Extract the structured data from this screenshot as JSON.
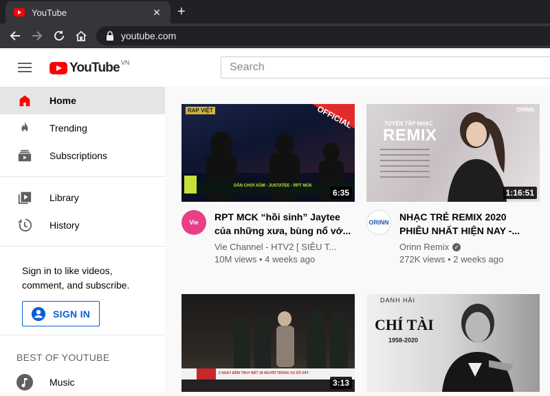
{
  "browser": {
    "tab_title": "YouTube",
    "tab_close": "✕",
    "new_tab": "+",
    "url": "youtube.com"
  },
  "masthead": {
    "logo_text": "YouTube",
    "logo_country": "VN",
    "search_placeholder": "Search"
  },
  "sidebar": {
    "items": [
      {
        "label": "Home",
        "icon": "home-icon",
        "active": true
      },
      {
        "label": "Trending",
        "icon": "fire-icon"
      },
      {
        "label": "Subscriptions",
        "icon": "subscriptions-icon"
      },
      {
        "label": "Library",
        "icon": "library-icon"
      },
      {
        "label": "History",
        "icon": "history-icon"
      }
    ],
    "signin_text": "Sign in to like videos, comment, and subscribe.",
    "signin_button": "SIGN IN",
    "best_of_title": "BEST OF YOUTUBE",
    "best_of_items": [
      {
        "label": "Music",
        "icon": "music-icon"
      }
    ]
  },
  "videos": [
    {
      "title_line1": "RPT MCK “hồi sinh” Jaytee",
      "title_line2": "của những xưa, bùng nổ vớ...",
      "channel": "Vie Channel - HTV2 [ SIÊU T...",
      "stats": "10M views • 4 weeks ago",
      "duration": "6:35",
      "thumb_overlay": "OFFICIAL",
      "thumb_caption": "DÂN CHƠI XÓM - JUSTATEE - RPT MCK",
      "thumb_badge": "RAP VIỆT",
      "avatar_text": "Vie",
      "verified": false
    },
    {
      "title_line1": "NHẠC TRẺ REMIX 2020",
      "title_line2": "PHIÊU NHẤT HIỆN NAY -...",
      "channel": "Orinn Remix",
      "stats": "272K views • 2 weeks ago",
      "duration": "1:16:51",
      "thumb_small": "TUYỂN TẬP NHẠC",
      "thumb_big": "REMIX",
      "thumb_brand": "ORINN",
      "avatar_text": "ORINN",
      "verified": true
    },
    {
      "duration": "3:13",
      "thumb_caption": "2 NGÀY ĐÊM TRUY BẮT 36 NGƯỜI TRONG VỤ XÔ XÁT"
    },
    {
      "thumb_kicker": "DANH HÀI",
      "thumb_name": "CHÍ TÀI",
      "thumb_years": "1958-2020"
    }
  ],
  "colors": {
    "brand_red": "#ff0000",
    "link_blue": "#065fd4",
    "active_bg": "#e5e5e5"
  }
}
